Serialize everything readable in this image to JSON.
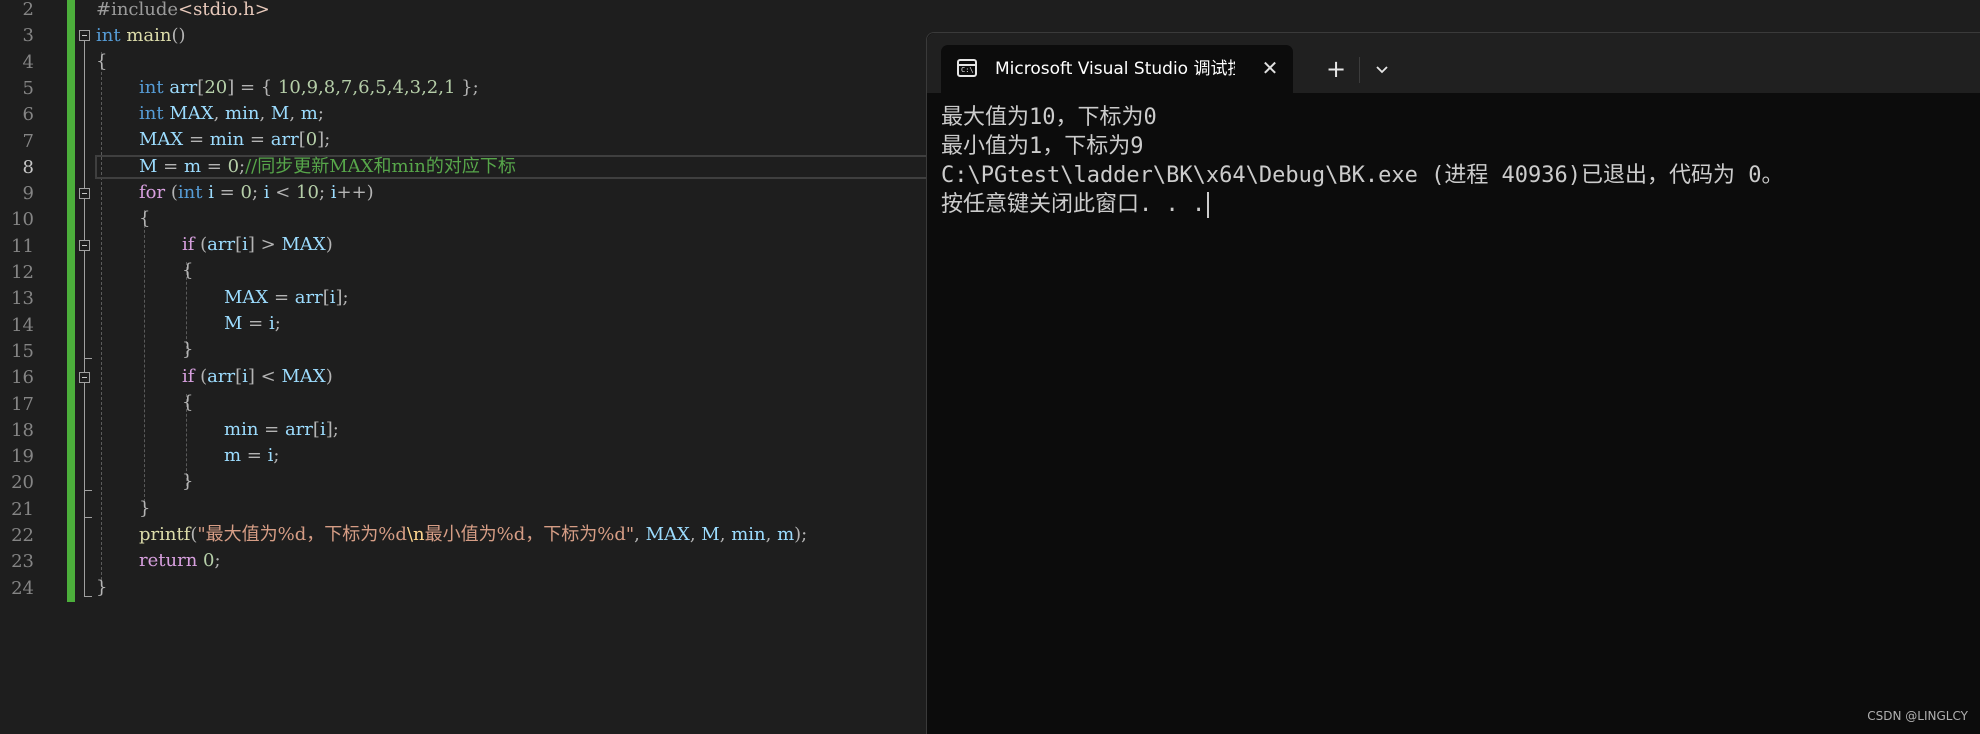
{
  "editor": {
    "line_numbers": [
      "2",
      "3",
      "4",
      "5",
      "6",
      "7",
      "8",
      "9",
      "10",
      "11",
      "12",
      "13",
      "14",
      "15",
      "16",
      "17",
      "18",
      "19",
      "20",
      "21",
      "22",
      "23",
      "24"
    ],
    "active_line": "8",
    "code": {
      "l2_pp": "#include",
      "l2_inc": "<stdio.h>",
      "l3_kw": "int",
      "l3_fn": "main",
      "l3_punc": "()",
      "l4_punc": "{",
      "l5_kw": "int",
      "l5_var": "arr",
      "l5_b1": "[",
      "l5_n1": "20",
      "l5_b2": "] = { ",
      "l5_vals": "10,9,8,7,6,5,4,3,2,1",
      "l5_end": " };",
      "l6_kw": "int",
      "l6_v1": "MAX",
      "l6_c1": ", ",
      "l6_v2": "min",
      "l6_c2": ", ",
      "l6_v3": "M",
      "l6_c3": ", ",
      "l6_v4": "m",
      "l6_end": ";",
      "l7_v1": "MAX",
      "l7_op1": " = ",
      "l7_v2": "min",
      "l7_op2": " = ",
      "l7_v3": "arr",
      "l7_b1": "[",
      "l7_n": "0",
      "l7_end": "];",
      "l8_v1": "M",
      "l8_op1": " = ",
      "l8_v2": "m",
      "l8_op2": " = ",
      "l8_n": "0",
      "l8_semi": ";",
      "l8_cmt": "//同步更新MAX和min的对应下标",
      "l9_kw": "for",
      "l9_p1": " (",
      "l9_kw2": "int",
      "l9_v1": "i",
      "l9_op1": " = ",
      "l9_n1": "0",
      "l9_s1": "; ",
      "l9_v2": "i",
      "l9_op2": " < ",
      "l9_n2": "10",
      "l9_s2": "; ",
      "l9_v3": "i",
      "l9_end": "++)",
      "l10_punc": "{",
      "l11_kw": "if",
      "l11_p1": " (",
      "l11_v1": "arr",
      "l11_b1": "[",
      "l11_v2": "i",
      "l11_b2": "] > ",
      "l11_v3": "MAX",
      "l11_end": ")",
      "l12_punc": "{",
      "l13_v1": "MAX",
      "l13_op": " = ",
      "l13_v2": "arr",
      "l13_b1": "[",
      "l13_v3": "i",
      "l13_end": "];",
      "l14_v1": "M",
      "l14_op": " = ",
      "l14_v2": "i",
      "l14_end": ";",
      "l15_punc": "}",
      "l16_kw": "if",
      "l16_p1": " (",
      "l16_v1": "arr",
      "l16_b1": "[",
      "l16_v2": "i",
      "l16_b2": "] < ",
      "l16_v3": "MAX",
      "l16_end": ")",
      "l17_punc": "{",
      "l18_v1": "min",
      "l18_op": " = ",
      "l18_v2": "arr",
      "l18_b1": "[",
      "l18_v3": "i",
      "l18_end": "];",
      "l19_v1": "m",
      "l19_op": " = ",
      "l19_v2": "i",
      "l19_end": ";",
      "l20_punc": "}",
      "l21_punc": "}",
      "l22_fn": "printf",
      "l22_p1": "(",
      "l22_s1": "\"最大值为%d，下标为%d",
      "l22_esc": "\\n",
      "l22_s2": "最小值为%d，下标为%d\"",
      "l22_c1": ", ",
      "l22_v1": "MAX",
      "l22_c2": ", ",
      "l22_v2": "M",
      "l22_c3": ", ",
      "l22_v3": "min",
      "l22_c4": ", ",
      "l22_v4": "m",
      "l22_end": ");",
      "l23_kw": "return",
      "l23_n": "0",
      "l23_end": ";",
      "l24_punc": "}"
    }
  },
  "terminal": {
    "tab_title": "Microsoft Visual Studio 调试控制台",
    "tab_icon_text": "C:\\",
    "close_glyph": "✕",
    "new_tab_glyph": "+",
    "output": [
      "最大值为10，下标为0",
      "最小值为1，下标为9",
      "C:\\PGtest\\ladder\\BK\\x64\\Debug\\BK.exe (进程 40936)已退出，代码为 0。",
      "按任意键关闭此窗口. . ."
    ]
  },
  "watermark": "CSDN @LINGLCY",
  "colors": {
    "editor_bg": "#1e1e1e",
    "terminal_bg": "#0c0c0c",
    "change_bar": "#4caf3b",
    "keyword": "#569cd6",
    "comment": "#57a64a",
    "string": "#d69d85"
  }
}
